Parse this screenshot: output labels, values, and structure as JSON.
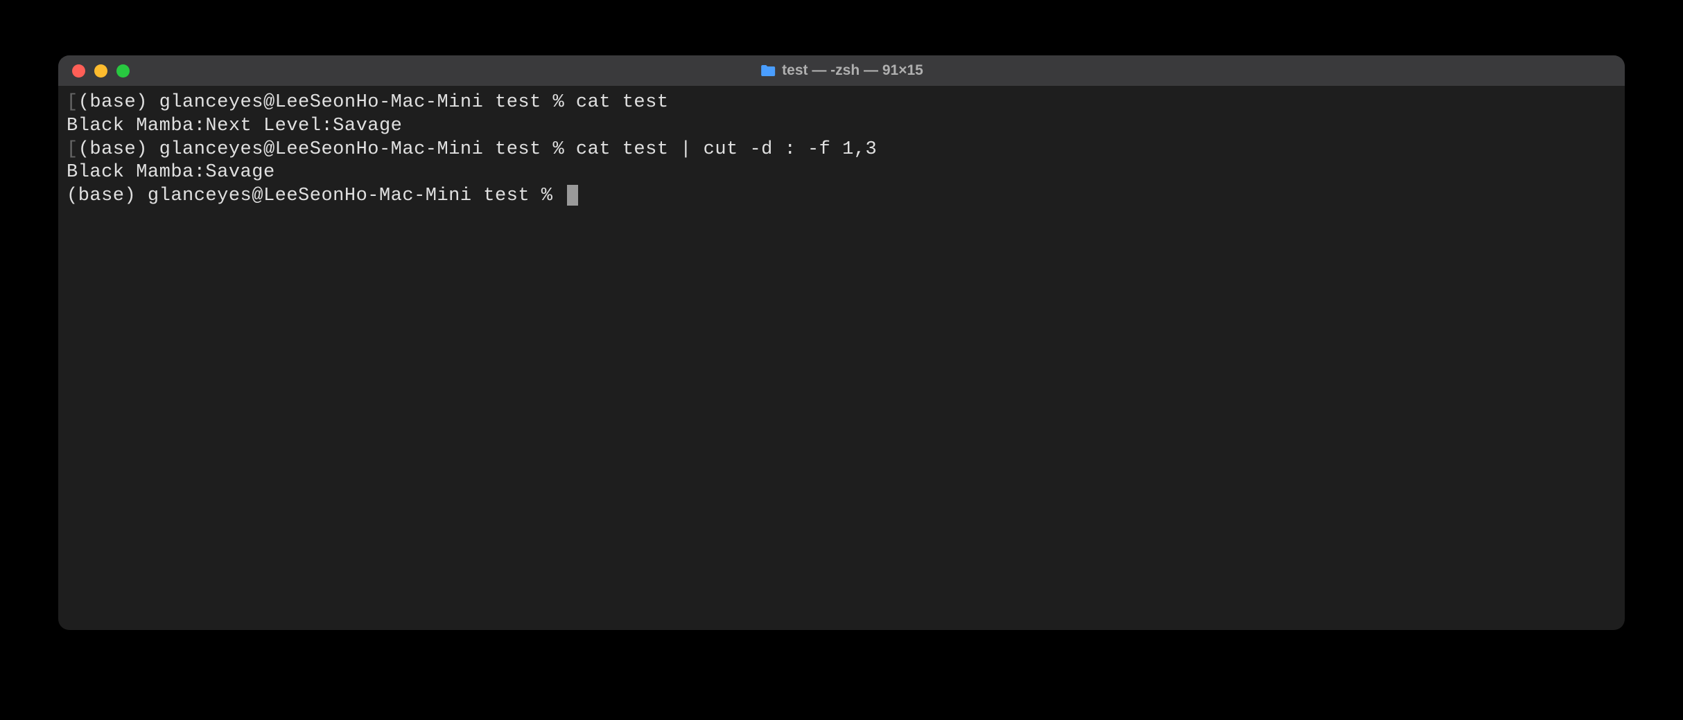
{
  "window": {
    "title": "test — -zsh — 91×15"
  },
  "terminal": {
    "lines": [
      {
        "marker": "[",
        "prompt": "(base) glanceyes@LeeSeonHo-Mac-Mini test % ",
        "command": "cat test",
        "end_marker": ""
      },
      {
        "output": "Black Mamba:Next Level:Savage"
      },
      {
        "marker": "[",
        "prompt": "(base) glanceyes@LeeSeonHo-Mac-Mini test % ",
        "command": "cat test | cut -d : -f 1,3",
        "end_marker": ""
      },
      {
        "output": "Black Mamba:Savage"
      },
      {
        "marker": "",
        "prompt": "(base) glanceyes@LeeSeonHo-Mac-Mini test % ",
        "command": "",
        "cursor": true
      }
    ]
  }
}
